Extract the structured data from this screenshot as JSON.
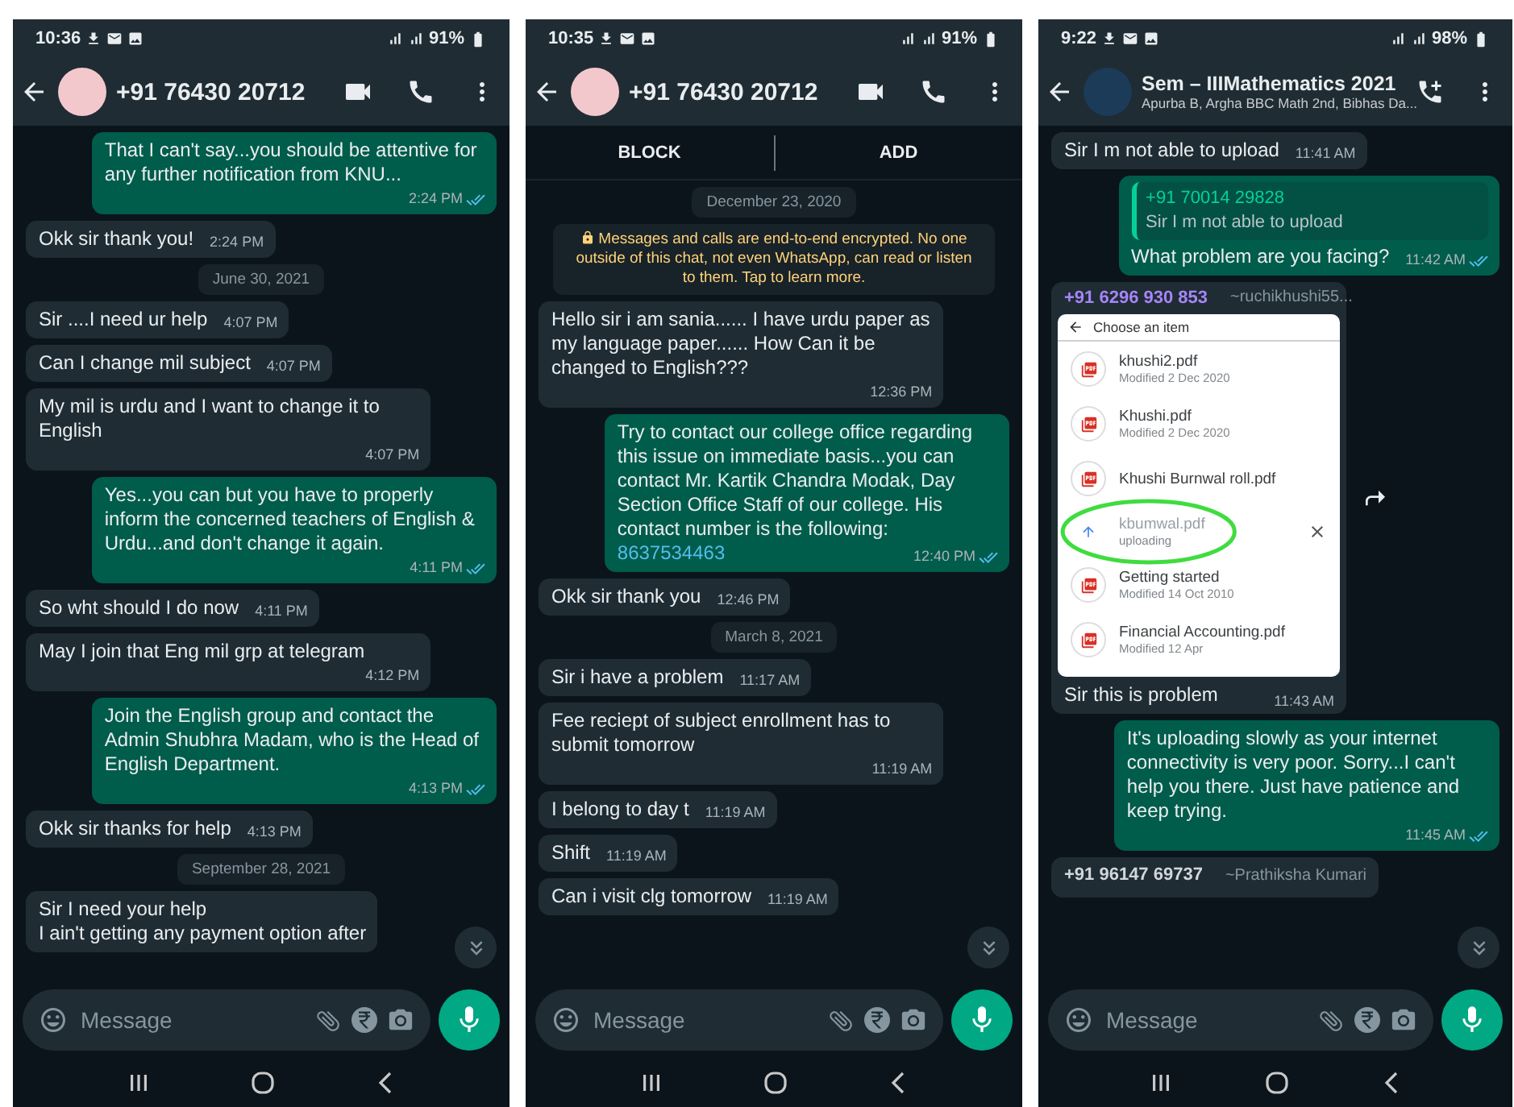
{
  "phones": [
    {
      "status_bar": {
        "time": "10:36",
        "battery": "91%"
      },
      "header": {
        "kind": "contact",
        "title": "+91 76430 20712"
      },
      "messages": [
        {
          "kind": "out",
          "text": "That I can't say...you should be attentive for any further notification from KNU...",
          "time": "2:24 PM",
          "read": true
        },
        {
          "kind": "in",
          "text": "Okk sir thank you!",
          "time": "2:24 PM"
        },
        {
          "kind": "date",
          "text": "June 30, 2021"
        },
        {
          "kind": "in",
          "text": "Sir ....I need ur help",
          "time": "4:07 PM"
        },
        {
          "kind": "in",
          "text": "Can I change mil subject",
          "time": "4:07 PM"
        },
        {
          "kind": "in",
          "text": "My mil is urdu and I want to change it to English",
          "time": "4:07 PM"
        },
        {
          "kind": "out",
          "text": "Yes...you can but you have to properly inform the concerned teachers of English & Urdu...and don't change it again.",
          "time": "4:11 PM",
          "read": true
        },
        {
          "kind": "in",
          "text": "So wht should I do now",
          "time": "4:11 PM"
        },
        {
          "kind": "in",
          "text": "May I join that Eng mil grp at telegram",
          "time": "4:12 PM"
        },
        {
          "kind": "out",
          "text": "Join the English group and contact the Admin Shubhra Madam, who is the Head of English Department.",
          "time": "4:13 PM",
          "read": true
        },
        {
          "kind": "in",
          "text": "Okk sir thanks for help",
          "time": "4:13 PM"
        },
        {
          "kind": "date",
          "text": "September 28, 2021"
        },
        {
          "kind": "in",
          "text": "Sir I need your help\nI ain't getting any payment option after"
        }
      ],
      "input": {
        "placeholder": "Message"
      }
    },
    {
      "status_bar": {
        "time": "10:35",
        "battery": "91%"
      },
      "header": {
        "kind": "contact",
        "title": "+91 76430 20712"
      },
      "actions": [
        "BLOCK",
        "ADD"
      ],
      "messages": [
        {
          "kind": "date",
          "text": "December 23, 2020"
        },
        {
          "kind": "notice",
          "text": "Messages and calls are end-to-end encrypted. No one outside of this chat, not even WhatsApp, can read or listen to them. Tap to learn more."
        },
        {
          "kind": "in",
          "text": "Hello sir i am sania...... I have urdu paper as my language paper......  How Can it be changed to English???",
          "time": "12:36 PM"
        },
        {
          "kind": "out",
          "text": "Try to contact our college office regarding this issue on immediate basis...you can contact Mr. Kartik Chandra Modak, Day Section Office Staff of our college. His contact number is the following:",
          "link": "8637534463",
          "time": "12:40 PM",
          "read": true
        },
        {
          "kind": "in",
          "text": "Okk sir thank you",
          "time": "12:46 PM"
        },
        {
          "kind": "date",
          "text": "March 8, 2021"
        },
        {
          "kind": "in",
          "text": "Sir i have a problem",
          "time": "11:17 AM"
        },
        {
          "kind": "in",
          "text": "Fee reciept of subject enrollment has to submit tomorrow",
          "time": "11:19 AM"
        },
        {
          "kind": "in",
          "text": "I belong to day t",
          "time": "11:19 AM"
        },
        {
          "kind": "in",
          "text": "Shift",
          "time": "11:19 AM"
        },
        {
          "kind": "in",
          "text": "Can i visit clg tomorrow",
          "time": "11:19 AM"
        }
      ],
      "input": {
        "placeholder": "Message"
      }
    },
    {
      "status_bar": {
        "time": "9:22",
        "battery": "98%"
      },
      "header": {
        "kind": "group",
        "title": "Sem – IIIMathematics 2021",
        "subtitle": "Apurba B, Argha BBC Math 2nd, Bibhas Da..."
      },
      "messages": [
        {
          "kind": "in",
          "text": "Sir I m not able to upload",
          "time": "11:41 AM"
        },
        {
          "kind": "out",
          "quote": {
            "sender": "+91 70014 29828",
            "text": "Sir I m not able to upload"
          },
          "text": "What problem are you facing?",
          "time": "11:42 AM",
          "read": true
        },
        {
          "kind": "picker",
          "sender": {
            "number": "+91 6296 930 853",
            "name": "~ruchikhushi55...",
            "color": "#a685f7"
          },
          "picker": {
            "title": "Choose an item",
            "files": [
              {
                "kind": "pdf",
                "name": "khushi2.pdf",
                "detail": "Modified 2 Dec 2020",
                "highlighted": false
              },
              {
                "kind": "pdf",
                "name": "Khushi.pdf",
                "detail": "Modified 2 Dec 2020",
                "highlighted": false
              },
              {
                "kind": "pdf",
                "name": "Khushi Burnwal roll.pdf",
                "highlighted": false
              },
              {
                "kind": "uploading",
                "name": "kbumwal.pdf",
                "detail": "uploading",
                "highlighted": true
              },
              {
                "kind": "pdf",
                "name": "Getting started",
                "detail": "Modified 14 Oct 2010",
                "highlighted": false
              },
              {
                "kind": "pdf",
                "name": "Financial Accounting.pdf",
                "detail": "Modified 12 Apr",
                "highlighted": false
              }
            ]
          },
          "text": "Sir this  is problem",
          "time": "11:43 AM"
        },
        {
          "kind": "out",
          "text": "It's uploading slowly as your internet connectivity is very poor. Sorry...I can't help you there. Just have patience and keep trying.",
          "time": "11:45 AM",
          "read": true
        },
        {
          "kind": "in",
          "sender": {
            "number": "+91 96147 69737",
            "name": "~Prathiksha Kumari",
            "color": "#d1d7db"
          }
        }
      ],
      "input": {
        "placeholder": "Message"
      }
    }
  ]
}
